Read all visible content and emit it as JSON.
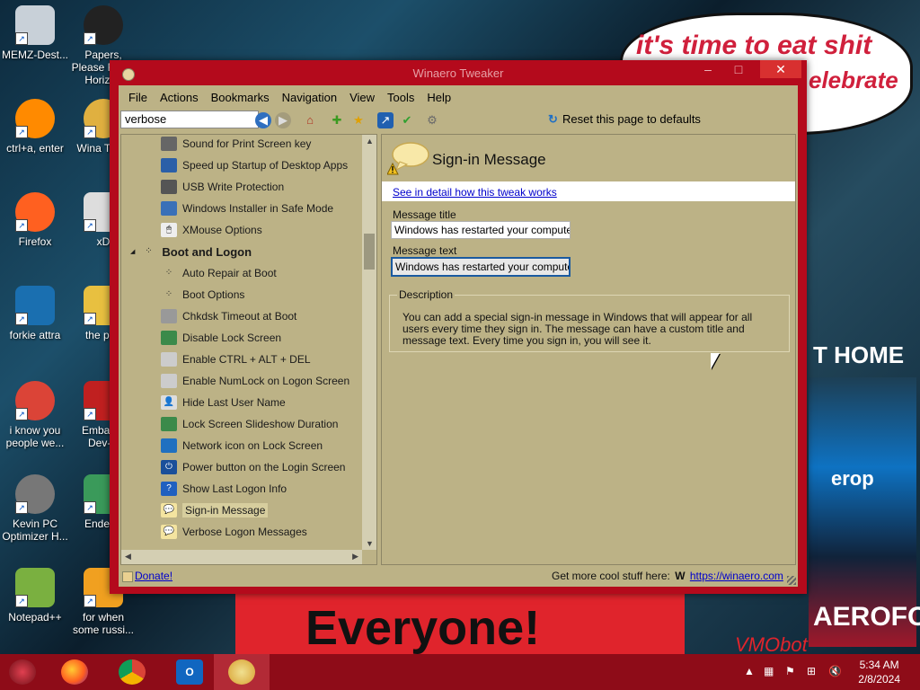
{
  "wallpaper": {
    "caption_line1": "it's time to eat shit",
    "caption_line2": "elebrate",
    "banner": "Everyone!",
    "sign_home": "T HOME",
    "sign_erop": "erop",
    "sign_aerofos": "AEROFOS",
    "sign_signature": "VMObot"
  },
  "desktop_icons": [
    {
      "label": "MEMZ-Dest...",
      "icon": "recycle-bin-icon"
    },
    {
      "label": "Papers, Please Forza Horizon",
      "icon": "papers-please-icon"
    },
    {
      "label": "ctrl+a, enter",
      "icon": "ring-icon"
    },
    {
      "label": "Wina Twea",
      "icon": "winaero-icon"
    },
    {
      "label": "Firefox",
      "icon": "firefox-icon"
    },
    {
      "label": "xD",
      "icon": "hex-icon"
    },
    {
      "label": "forkie attra",
      "icon": "monitor-gear-icon"
    },
    {
      "label": "the pop",
      "icon": "document-icon"
    },
    {
      "label": "i know you people we...",
      "icon": "chrome-icon"
    },
    {
      "label": "Embarca Dev-C",
      "icon": "devcpp-icon"
    },
    {
      "label": "Kevin PC Optimizer H...",
      "icon": "gauge-icon"
    },
    {
      "label": "Enderm",
      "icon": "image-icon"
    },
    {
      "label": "Notepad++",
      "icon": "notepadpp-icon"
    },
    {
      "label": "for when some russi...",
      "icon": "de-icon"
    }
  ],
  "window": {
    "title": "Winaero Tweaker",
    "menu": [
      "File",
      "Actions",
      "Bookmarks",
      "Navigation",
      "View",
      "Tools",
      "Help"
    ],
    "search_value": "verbose",
    "reset_label": "Reset this page to defaults",
    "tree": [
      {
        "label": "Sound for Print Screen key",
        "icon": "speaker-icon",
        "type": "item"
      },
      {
        "label": "Speed up Startup of Desktop Apps",
        "icon": "monitor-icon",
        "type": "item"
      },
      {
        "label": "USB Write Protection",
        "icon": "usb-icon",
        "type": "item"
      },
      {
        "label": "Windows Installer in Safe Mode",
        "icon": "installer-icon",
        "type": "item"
      },
      {
        "label": "XMouse Options",
        "icon": "mouse-icon",
        "type": "item"
      },
      {
        "label": "Boot and Logon",
        "icon": "spinner-icon",
        "type": "category"
      },
      {
        "label": "Auto Repair at Boot",
        "icon": "spinner-icon",
        "type": "item"
      },
      {
        "label": "Boot Options",
        "icon": "spinner-icon",
        "type": "item"
      },
      {
        "label": "Chkdsk Timeout at Boot",
        "icon": "disk-icon",
        "type": "item"
      },
      {
        "label": "Disable Lock Screen",
        "icon": "landscape-icon",
        "type": "item"
      },
      {
        "label": "Enable CTRL + ALT + DEL",
        "icon": "keyboard-icon",
        "type": "item"
      },
      {
        "label": "Enable NumLock on Logon Screen",
        "icon": "keyboard-icon",
        "type": "item"
      },
      {
        "label": "Hide Last User Name",
        "icon": "user-icon",
        "type": "item"
      },
      {
        "label": "Lock Screen Slideshow Duration",
        "icon": "landscape-icon",
        "type": "item"
      },
      {
        "label": "Network icon on Lock Screen",
        "icon": "network-icon",
        "type": "item"
      },
      {
        "label": "Power button on the Login Screen",
        "icon": "power-icon",
        "type": "item"
      },
      {
        "label": "Show Last Logon Info",
        "icon": "help-icon",
        "type": "item"
      },
      {
        "label": "Sign-in Message",
        "icon": "speech-bubble-icon",
        "type": "item",
        "selected": true
      },
      {
        "label": "Verbose Logon Messages",
        "icon": "speech-bubble-icon",
        "type": "item"
      }
    ],
    "right": {
      "title": "Sign-in Message",
      "detail_link": "See in detail how this tweak works",
      "message_title_label": "Message title",
      "message_title_value": "Windows has restarted your computer",
      "message_text_label": "Message text",
      "message_text_value": "Windows has restarted your computer in",
      "description_legend": "Description",
      "description": "You can add a special sign-in message in Windows that will appear for all users every time they sign in. The message can have a custom title and message text. Every time you sign in, you will see it."
    },
    "status": {
      "donate": "Donate!",
      "more_text": "Get more cool stuff here:",
      "more_link": "https://winaero.com"
    }
  },
  "taskbar": {
    "apps": [
      "firefox-icon",
      "chrome-icon",
      "outlook-icon",
      "winaero-icon"
    ],
    "time": "5:34 AM",
    "date": "2/8/2024"
  },
  "colors": {
    "window_frame": "#b40a1c",
    "client_bg": "#bcb286",
    "taskbar": "#8e0c18",
    "link": "#0000cc"
  }
}
